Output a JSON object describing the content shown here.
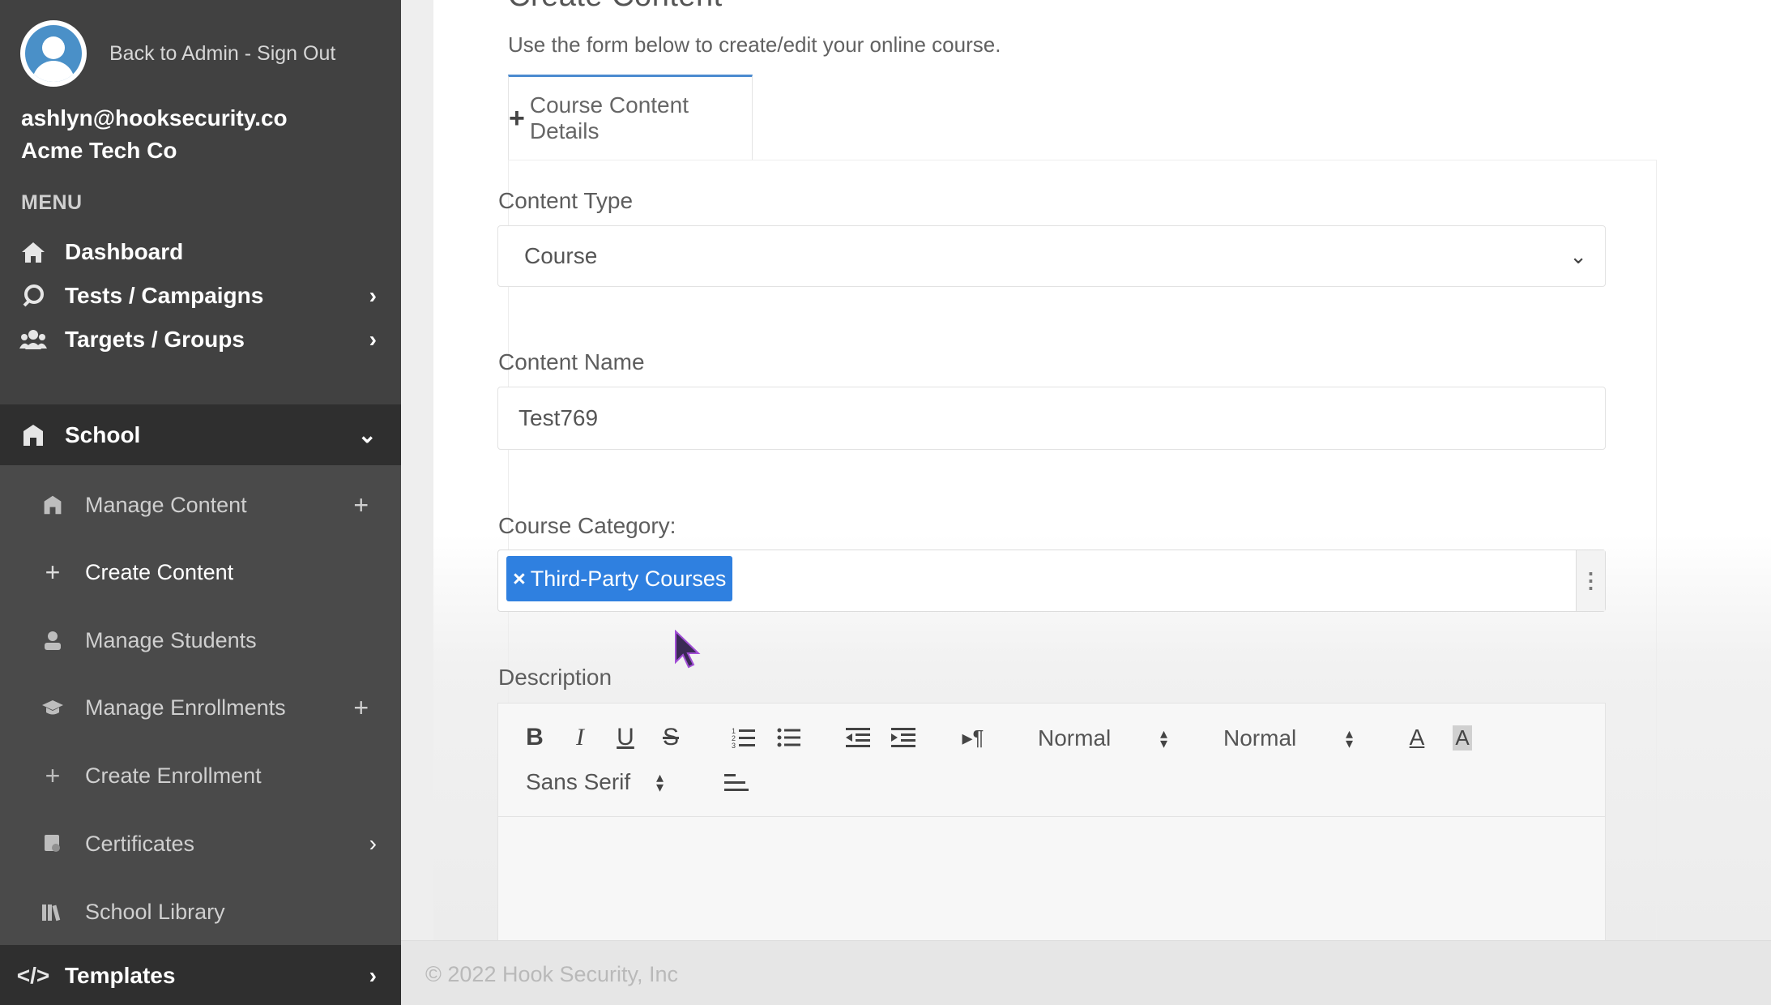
{
  "sidebar": {
    "profile_links": "Back to Admin - Sign Out",
    "user_email": "ashlyn@hooksecurity.co",
    "user_company": "Acme Tech Co",
    "menu_heading": "MENU",
    "items": [
      {
        "label": "Dashboard",
        "icon": "home-icon"
      },
      {
        "label": "Tests / Campaigns",
        "icon": "rocket-icon"
      },
      {
        "label": "Targets / Groups",
        "icon": "users-icon"
      },
      {
        "label": "School",
        "icon": "school-icon"
      },
      {
        "label": "Templates",
        "icon": "code-icon"
      }
    ],
    "school_submenu": [
      {
        "label": "Manage Content",
        "icon": "school-icon"
      },
      {
        "label": "Create Content",
        "icon": "plus-icon"
      },
      {
        "label": "Manage Students",
        "icon": "student-icon"
      },
      {
        "label": "Manage Enrollments",
        "icon": "graduation-cap-icon"
      },
      {
        "label": "Create Enrollment",
        "icon": "plus-icon"
      },
      {
        "label": "Certificates",
        "icon": "certificate-icon"
      },
      {
        "label": "School Library",
        "icon": "library-icon"
      }
    ]
  },
  "page": {
    "title": "Create Content",
    "subtitle": "Use the form below to create/edit your online course.",
    "tab_label": "Course Content Details"
  },
  "form": {
    "content_type_label": "Content Type",
    "content_type_value": "Course",
    "content_name_label": "Content Name",
    "content_name_value": "Test769",
    "course_category_label": "Course Category:",
    "course_category_tag": "Third-Party Courses",
    "description_label": "Description"
  },
  "editor_toolbar": {
    "header_select": "Normal",
    "size_select": "Normal",
    "font_select": "Sans Serif"
  },
  "footer": {
    "copyright": "© 2022 Hook Security, Inc"
  },
  "colors": {
    "sidebar_bg": "#414141",
    "sidebar_active_bg": "#2f2f2f",
    "accent": "#2f80e0",
    "tab_border": "#4b8bd0"
  }
}
